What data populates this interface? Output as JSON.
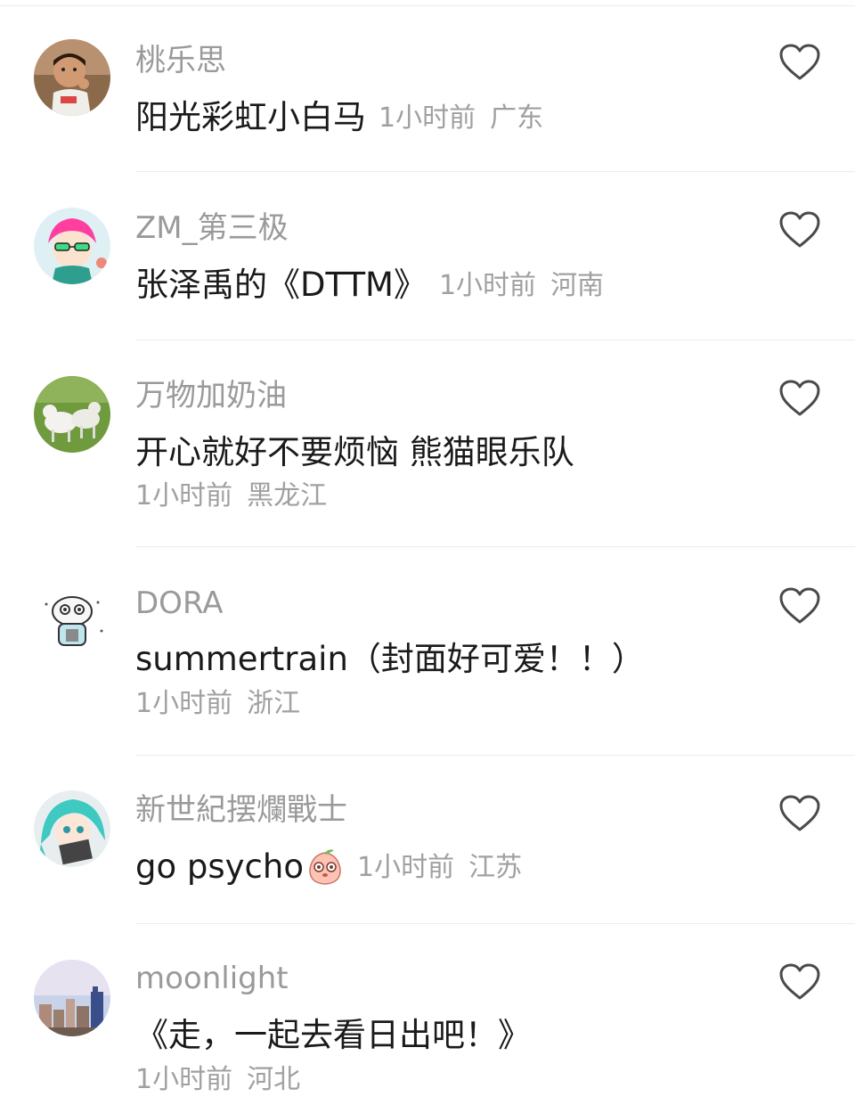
{
  "comments": [
    {
      "username": "桃乐思",
      "text": "阳光彩虹小白马",
      "time": "1小时前",
      "location": "广东",
      "avatar_icon": "child-photo-avatar"
    },
    {
      "username": "ZM_第三极",
      "text": "张泽禹的《DTTM》",
      "time": "1小时前",
      "location": "河南",
      "avatar_icon": "anime-pink-hair-avatar"
    },
    {
      "username": "万物加奶油",
      "text": "开心就好不要烦恼 熊猫眼乐队",
      "time": "1小时前",
      "location": "黑龙江",
      "avatar_icon": "goats-photo-avatar"
    },
    {
      "username": "DORA",
      "text": "summertrain（封面好可爱！！）",
      "time": "1小时前",
      "location": "浙江",
      "avatar_icon": "cartoon-creature-avatar"
    },
    {
      "username": "新世紀摆爛戰士",
      "text": "go psycho",
      "time": "1小时前",
      "location": "江苏",
      "avatar_icon": "anime-teal-hair-avatar",
      "emoji_icon": "peach-face-emoji"
    },
    {
      "username": "moonlight",
      "text": "《走，一起去看日出吧！》",
      "time": "1小时前",
      "location": "河北",
      "avatar_icon": "city-skyline-avatar"
    }
  ],
  "colors": {
    "username": "#9a9a9a",
    "text": "#1a1a1a",
    "meta": "#a0a0a0",
    "divider": "#ececec",
    "heart_stroke": "#4a4a4a"
  }
}
